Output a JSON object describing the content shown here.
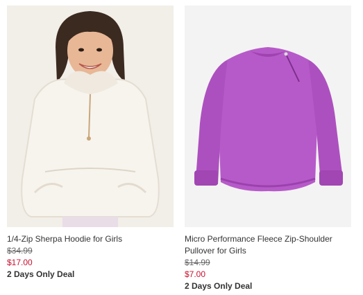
{
  "products": [
    {
      "name": "1/4-Zip Sherpa Hoodie for Girls",
      "original_price": "$34.99",
      "sale_price": "$17.00",
      "promo": "2 Days Only Deal"
    },
    {
      "name": "Micro Performance Fleece Zip-Shoulder Pullover for Girls",
      "original_price": "$14.99",
      "sale_price": "$7.00",
      "promo": "2 Days Only Deal"
    }
  ],
  "colors": {
    "sale_price": "#c8102e",
    "pullover": "#b75ac9",
    "hoodie": "#f6f3ec"
  }
}
